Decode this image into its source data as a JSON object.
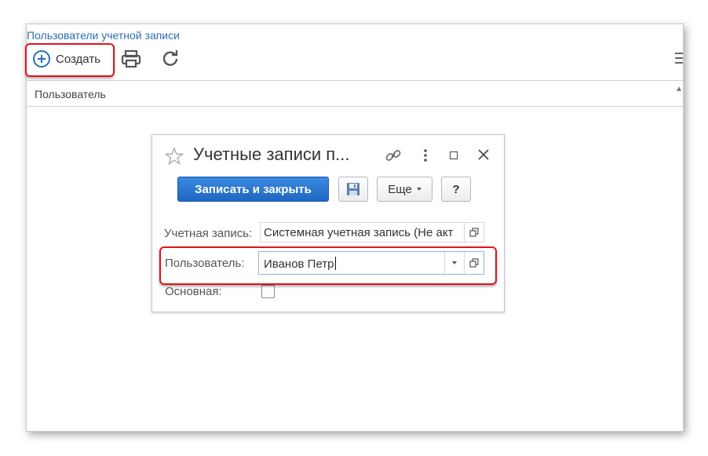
{
  "window": {
    "breadcrumb": "Пользователи учетной записи",
    "toolbar": {
      "create_label": "Создать",
      "print_icon": "printer-icon",
      "refresh_icon": "refresh-icon",
      "menu_icon": "hamburger-menu-icon"
    },
    "table": {
      "columns": [
        "Пользователь"
      ]
    }
  },
  "dialog": {
    "title": "Учетные записи п...",
    "buttons": {
      "save_close": "Записать и закрыть",
      "more": "Еще",
      "help": "?"
    },
    "fields": {
      "account_label": "Учетная запись:",
      "account_value": "Системная учетная запись (Не акт",
      "user_label": "Пользователь:",
      "user_value": "Иванов Петр",
      "main_label": "Основная:",
      "main_checked": false
    }
  },
  "colors": {
    "accent": "#2a6fb5",
    "primary_button": "#1f66c2",
    "highlight": "#e0141e"
  }
}
